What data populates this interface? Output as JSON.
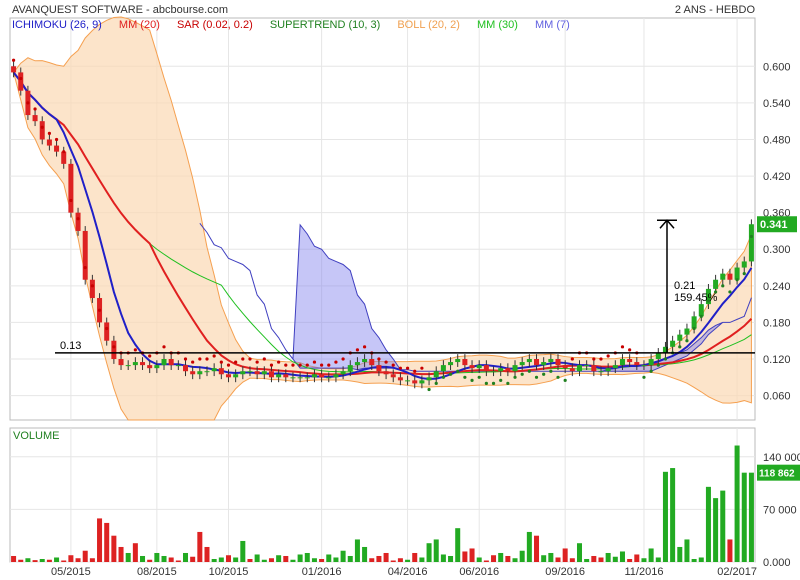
{
  "header": {
    "title": "AVANQUEST SOFTWARE - abcbourse.com",
    "period": "2 ANS - HEBDO"
  },
  "legend": [
    {
      "label": "ICHIMOKU (26, 9)",
      "color": "#2020c8"
    },
    {
      "label": "MM (20)",
      "color": "#e02020"
    },
    {
      "label": "SAR (0.02, 0.2)",
      "color": "#c80000"
    },
    {
      "label": "SUPERTREND (10, 3)",
      "color": "#208020"
    },
    {
      "label": "BOLL (20, 2)",
      "color": "#f0a050"
    },
    {
      "label": "MM (30)",
      "color": "#20c020"
    },
    {
      "label": "MM (7)",
      "color": "#6060e0"
    }
  ],
  "annotations": {
    "support_label": "0.13",
    "gain_value": "0.21",
    "gain_percent": "159.45%",
    "last_price": "0.341",
    "last_volume": "118 862",
    "volume_title": "VOLUME"
  },
  "colors": {
    "up": "#22aa22",
    "down": "#dd2222",
    "cloud": "#8080ee",
    "bollinger": "#f5a050",
    "price_badge": "#22aa22"
  },
  "chart_data": [
    {
      "type": "candlestick",
      "title": "AVANQUEST SOFTWARE - abcbourse.com",
      "x_ticks": [
        "05/2015",
        "08/2015",
        "10/2015",
        "01/2016",
        "04/2016",
        "06/2016",
        "09/2016",
        "11/2016",
        "02/2017"
      ],
      "y_ticks": [
        "0.600",
        "0.540",
        "0.480",
        "0.420",
        "0.360",
        "0.300",
        "0.240",
        "0.180",
        "0.120",
        "0.060"
      ],
      "ylim": [
        0.02,
        0.63
      ],
      "weeks": 104,
      "last_close": 0.341,
      "support_level": 0.13,
      "gain": {
        "value": 0.21,
        "percent": "159.45%"
      },
      "grid": true,
      "close": [
        0.59,
        0.56,
        0.52,
        0.51,
        0.48,
        0.47,
        0.46,
        0.44,
        0.36,
        0.33,
        0.25,
        0.22,
        0.18,
        0.15,
        0.12,
        0.11,
        0.11,
        0.115,
        0.11,
        0.105,
        0.11,
        0.12,
        0.11,
        0.11,
        0.1,
        0.095,
        0.1,
        0.1,
        0.105,
        0.095,
        0.09,
        0.095,
        0.1,
        0.1,
        0.095,
        0.1,
        0.09,
        0.095,
        0.09,
        0.09,
        0.09,
        0.09,
        0.095,
        0.09,
        0.09,
        0.095,
        0.1,
        0.11,
        0.115,
        0.12,
        0.11,
        0.1,
        0.095,
        0.09,
        0.085,
        0.085,
        0.08,
        0.085,
        0.09,
        0.1,
        0.11,
        0.115,
        0.12,
        0.11,
        0.105,
        0.11,
        0.1,
        0.1,
        0.105,
        0.1,
        0.11,
        0.115,
        0.12,
        0.11,
        0.115,
        0.12,
        0.11,
        0.105,
        0.1,
        0.11,
        0.11,
        0.1,
        0.1,
        0.105,
        0.11,
        0.12,
        0.115,
        0.11,
        0.11,
        0.12,
        0.13,
        0.14,
        0.15,
        0.16,
        0.17,
        0.19,
        0.21,
        0.235,
        0.25,
        0.26,
        0.25,
        0.27,
        0.28,
        0.341
      ],
      "volume": {
        "title": "VOLUME",
        "y_ticks": [
          "140 000",
          "70 000",
          "0.000"
        ],
        "ylim": [
          0,
          165000
        ],
        "last": 118862,
        "values": [
          8000,
          3000,
          5000,
          2500,
          4000,
          3000,
          6000,
          2000,
          9000,
          5000,
          15000,
          5000,
          58000,
          52000,
          35000,
          20000,
          12000,
          25000,
          8000,
          3000,
          12000,
          8000,
          6000,
          2000,
          12000,
          7000,
          40000,
          20000,
          4000,
          6000,
          9000,
          6000,
          28000,
          4000,
          10000,
          3000,
          5000,
          9000,
          8000,
          3000,
          10000,
          12000,
          5000,
          4000,
          10000,
          6000,
          15000,
          8000,
          30000,
          20000,
          5000,
          8000,
          12000,
          2000,
          5000,
          3000,
          12000,
          6000,
          25000,
          30000,
          10000,
          8000,
          45000,
          14000,
          18000,
          6000,
          2000,
          9000,
          12000,
          8000,
          5000,
          15000,
          40000,
          35000,
          9000,
          12000,
          6000,
          18000,
          5000,
          25000,
          4000,
          8000,
          6000,
          12000,
          7000,
          14000,
          4000,
          10000,
          5000,
          18000,
          6000,
          120000,
          125000,
          20000,
          30000,
          4000,
          6000,
          100000,
          85000,
          95000,
          30000,
          155000,
          118862,
          118862
        ],
        "volume_up": [
          false,
          false,
          true,
          false,
          true,
          false,
          true,
          false,
          false,
          false,
          false,
          false,
          false,
          false,
          false,
          false,
          true,
          false,
          true,
          false,
          true,
          true,
          false,
          false,
          true,
          false,
          false,
          false,
          true,
          true,
          false,
          true,
          true,
          false,
          true,
          true,
          false,
          true,
          false,
          true,
          true,
          true,
          true,
          false,
          true,
          true,
          true,
          true,
          true,
          true,
          false,
          false,
          false,
          false,
          false,
          true,
          false,
          true,
          true,
          true,
          true,
          true,
          true,
          false,
          false,
          true,
          false,
          false,
          true,
          false,
          true,
          true,
          true,
          false,
          true,
          true,
          false,
          false,
          false,
          true,
          true,
          false,
          false,
          true,
          true,
          true,
          false,
          false,
          true,
          true,
          true,
          true,
          true,
          true,
          true,
          true,
          true,
          true,
          true,
          true,
          false,
          true,
          true,
          true
        ]
      },
      "bottom_labels": [
        "05/2015",
        "08/2015",
        "10/2015",
        "01/2016",
        "04/2016",
        "06/2016",
        "09/2016",
        "11/2016",
        "02/2017"
      ]
    }
  ]
}
